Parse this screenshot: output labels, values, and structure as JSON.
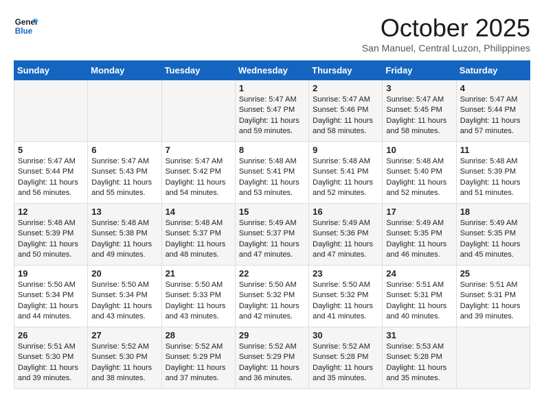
{
  "header": {
    "logo_line1": "General",
    "logo_line2": "Blue",
    "month_title": "October 2025",
    "location": "San Manuel, Central Luzon, Philippines"
  },
  "days_of_week": [
    "Sunday",
    "Monday",
    "Tuesday",
    "Wednesday",
    "Thursday",
    "Friday",
    "Saturday"
  ],
  "weeks": [
    [
      {
        "day": "",
        "info": ""
      },
      {
        "day": "",
        "info": ""
      },
      {
        "day": "",
        "info": ""
      },
      {
        "day": "1",
        "info": "Sunrise: 5:47 AM\nSunset: 5:47 PM\nDaylight: 11 hours\nand 59 minutes."
      },
      {
        "day": "2",
        "info": "Sunrise: 5:47 AM\nSunset: 5:46 PM\nDaylight: 11 hours\nand 58 minutes."
      },
      {
        "day": "3",
        "info": "Sunrise: 5:47 AM\nSunset: 5:45 PM\nDaylight: 11 hours\nand 58 minutes."
      },
      {
        "day": "4",
        "info": "Sunrise: 5:47 AM\nSunset: 5:44 PM\nDaylight: 11 hours\nand 57 minutes."
      }
    ],
    [
      {
        "day": "5",
        "info": "Sunrise: 5:47 AM\nSunset: 5:44 PM\nDaylight: 11 hours\nand 56 minutes."
      },
      {
        "day": "6",
        "info": "Sunrise: 5:47 AM\nSunset: 5:43 PM\nDaylight: 11 hours\nand 55 minutes."
      },
      {
        "day": "7",
        "info": "Sunrise: 5:47 AM\nSunset: 5:42 PM\nDaylight: 11 hours\nand 54 minutes."
      },
      {
        "day": "8",
        "info": "Sunrise: 5:48 AM\nSunset: 5:41 PM\nDaylight: 11 hours\nand 53 minutes."
      },
      {
        "day": "9",
        "info": "Sunrise: 5:48 AM\nSunset: 5:41 PM\nDaylight: 11 hours\nand 52 minutes."
      },
      {
        "day": "10",
        "info": "Sunrise: 5:48 AM\nSunset: 5:40 PM\nDaylight: 11 hours\nand 52 minutes."
      },
      {
        "day": "11",
        "info": "Sunrise: 5:48 AM\nSunset: 5:39 PM\nDaylight: 11 hours\nand 51 minutes."
      }
    ],
    [
      {
        "day": "12",
        "info": "Sunrise: 5:48 AM\nSunset: 5:39 PM\nDaylight: 11 hours\nand 50 minutes."
      },
      {
        "day": "13",
        "info": "Sunrise: 5:48 AM\nSunset: 5:38 PM\nDaylight: 11 hours\nand 49 minutes."
      },
      {
        "day": "14",
        "info": "Sunrise: 5:48 AM\nSunset: 5:37 PM\nDaylight: 11 hours\nand 48 minutes."
      },
      {
        "day": "15",
        "info": "Sunrise: 5:49 AM\nSunset: 5:37 PM\nDaylight: 11 hours\nand 47 minutes."
      },
      {
        "day": "16",
        "info": "Sunrise: 5:49 AM\nSunset: 5:36 PM\nDaylight: 11 hours\nand 47 minutes."
      },
      {
        "day": "17",
        "info": "Sunrise: 5:49 AM\nSunset: 5:35 PM\nDaylight: 11 hours\nand 46 minutes."
      },
      {
        "day": "18",
        "info": "Sunrise: 5:49 AM\nSunset: 5:35 PM\nDaylight: 11 hours\nand 45 minutes."
      }
    ],
    [
      {
        "day": "19",
        "info": "Sunrise: 5:50 AM\nSunset: 5:34 PM\nDaylight: 11 hours\nand 44 minutes."
      },
      {
        "day": "20",
        "info": "Sunrise: 5:50 AM\nSunset: 5:34 PM\nDaylight: 11 hours\nand 43 minutes."
      },
      {
        "day": "21",
        "info": "Sunrise: 5:50 AM\nSunset: 5:33 PM\nDaylight: 11 hours\nand 43 minutes."
      },
      {
        "day": "22",
        "info": "Sunrise: 5:50 AM\nSunset: 5:32 PM\nDaylight: 11 hours\nand 42 minutes."
      },
      {
        "day": "23",
        "info": "Sunrise: 5:50 AM\nSunset: 5:32 PM\nDaylight: 11 hours\nand 41 minutes."
      },
      {
        "day": "24",
        "info": "Sunrise: 5:51 AM\nSunset: 5:31 PM\nDaylight: 11 hours\nand 40 minutes."
      },
      {
        "day": "25",
        "info": "Sunrise: 5:51 AM\nSunset: 5:31 PM\nDaylight: 11 hours\nand 39 minutes."
      }
    ],
    [
      {
        "day": "26",
        "info": "Sunrise: 5:51 AM\nSunset: 5:30 PM\nDaylight: 11 hours\nand 39 minutes."
      },
      {
        "day": "27",
        "info": "Sunrise: 5:52 AM\nSunset: 5:30 PM\nDaylight: 11 hours\nand 38 minutes."
      },
      {
        "day": "28",
        "info": "Sunrise: 5:52 AM\nSunset: 5:29 PM\nDaylight: 11 hours\nand 37 minutes."
      },
      {
        "day": "29",
        "info": "Sunrise: 5:52 AM\nSunset: 5:29 PM\nDaylight: 11 hours\nand 36 minutes."
      },
      {
        "day": "30",
        "info": "Sunrise: 5:52 AM\nSunset: 5:28 PM\nDaylight: 11 hours\nand 35 minutes."
      },
      {
        "day": "31",
        "info": "Sunrise: 5:53 AM\nSunset: 5:28 PM\nDaylight: 11 hours\nand 35 minutes."
      },
      {
        "day": "",
        "info": ""
      }
    ]
  ]
}
